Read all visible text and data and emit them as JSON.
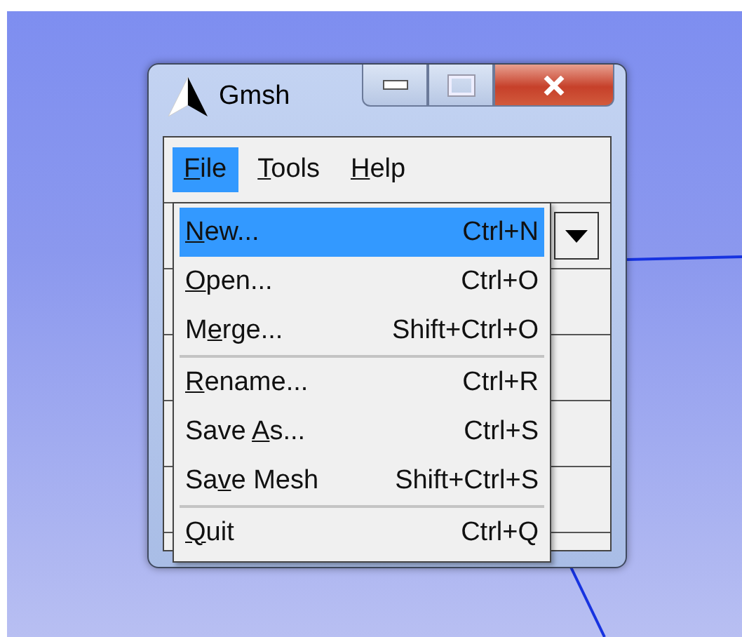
{
  "window": {
    "title": "Gmsh"
  },
  "menu_bar": [
    {
      "key": "F",
      "after": "ile",
      "selected": true
    },
    {
      "key": "T",
      "after": "ools",
      "selected": false
    },
    {
      "key": "H",
      "after": "elp",
      "selected": false
    }
  ],
  "file_menu": [
    {
      "key": "N",
      "after": "ew...",
      "shortcut": "Ctrl+N",
      "selected": true,
      "separator_above": false
    },
    {
      "key": "O",
      "after": "pen...",
      "shortcut": "Ctrl+O",
      "selected": false,
      "separator_above": false
    },
    {
      "before": "M",
      "key": "e",
      "after": "rge...",
      "shortcut": "Shift+Ctrl+O",
      "selected": false,
      "separator_above": false
    },
    {
      "key": "R",
      "after": "ename...",
      "shortcut": "Ctrl+R",
      "selected": false,
      "separator_above": true
    },
    {
      "before": "Save ",
      "key": "A",
      "after": "s...",
      "shortcut": "Ctrl+S",
      "selected": false,
      "separator_above": false
    },
    {
      "before": "Sa",
      "key": "v",
      "after": "e Mesh",
      "shortcut": "Shift+Ctrl+S",
      "selected": false,
      "separator_above": false
    },
    {
      "key": "Q",
      "after": "uit",
      "shortcut": "Ctrl+Q",
      "selected": false,
      "separator_above": true
    }
  ]
}
